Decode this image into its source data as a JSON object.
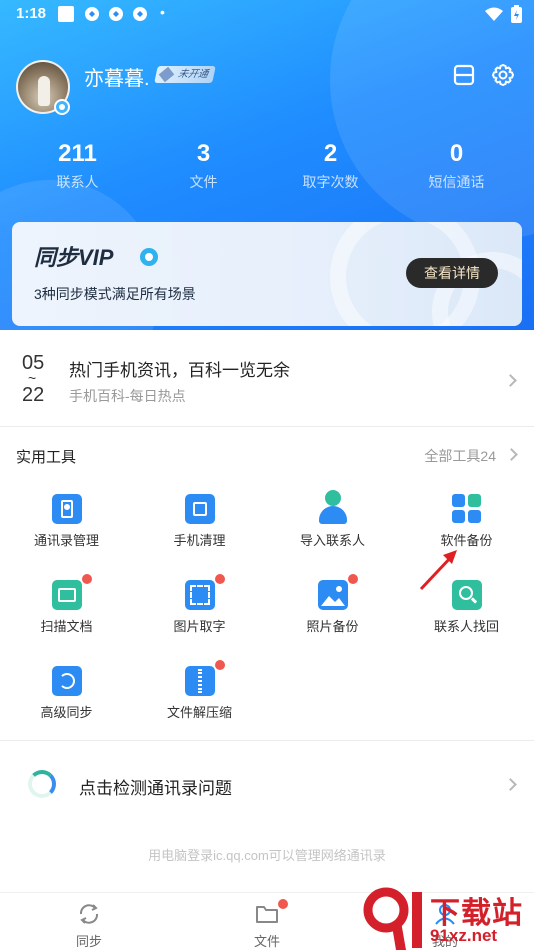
{
  "status_bar": {
    "time": "1:18",
    "dot": "•"
  },
  "profile": {
    "name": "亦暮暮.",
    "vip_status": "未开通"
  },
  "stats": [
    {
      "value": "211",
      "label": "联系人"
    },
    {
      "value": "3",
      "label": "文件"
    },
    {
      "value": "2",
      "label": "取字次数"
    },
    {
      "value": "0",
      "label": "短信通话"
    }
  ],
  "vip_card": {
    "title": "同步VIP",
    "description": "3种同步模式满足所有场景",
    "button": "查看详情"
  },
  "news": {
    "date_start": "05",
    "date_sep": "~",
    "date_end": "22",
    "headline": "热门手机资讯，百科一览无余",
    "source": "手机百科-每日热点"
  },
  "tools": {
    "title": "实用工具",
    "all_link": "全部工具24",
    "items": [
      {
        "label": "通讯录管理",
        "icon": "contacts-book-icon",
        "badge": false
      },
      {
        "label": "手机清理",
        "icon": "phone-clean-icon",
        "badge": false
      },
      {
        "label": "导入联系人",
        "icon": "import-contact-icon",
        "badge": false
      },
      {
        "label": "软件备份",
        "icon": "app-backup-icon",
        "badge": false
      },
      {
        "label": "扫描文档",
        "icon": "scan-document-icon",
        "badge": true
      },
      {
        "label": "图片取字",
        "icon": "image-text-icon",
        "badge": true
      },
      {
        "label": "照片备份",
        "icon": "photo-backup-icon",
        "badge": true
      },
      {
        "label": "联系人找回",
        "icon": "contact-recover-icon",
        "badge": false
      },
      {
        "label": "高级同步",
        "icon": "advanced-sync-icon",
        "badge": false
      },
      {
        "label": "文件解压缩",
        "icon": "file-unzip-icon",
        "badge": true
      }
    ]
  },
  "detect": {
    "label": "点击检测通讯录问题"
  },
  "footer_note": "用电脑登录ic.qq.com可以管理网络通讯录",
  "tabbar": [
    {
      "label": "同步",
      "icon": "sync-icon",
      "badge": false
    },
    {
      "label": "文件",
      "icon": "folder-icon",
      "badge": true
    },
    {
      "label": "我的",
      "icon": "profile-icon",
      "badge": false
    }
  ],
  "watermark": {
    "line1": "下载站",
    "line2": "91xz.net"
  },
  "colors": {
    "primary": "#1f8cff",
    "accent_red": "#f0574e",
    "dark_button": "#2a2a2a"
  }
}
